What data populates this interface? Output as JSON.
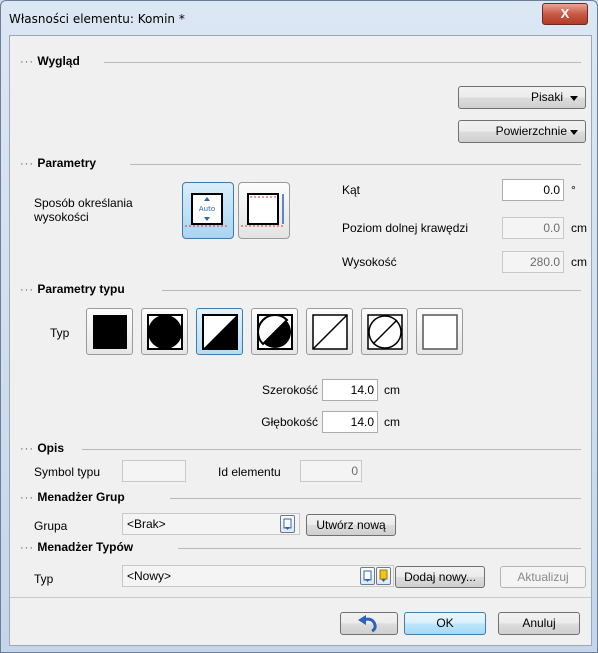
{
  "window": {
    "title": "Własności elementu: Komin *",
    "close_glyph": "X"
  },
  "sections": {
    "wyglad": "Wygląd",
    "parametry": "Parametry",
    "parametry_typu": "Parametry typu",
    "opis": "Opis",
    "menadzer_grup": "Menadżer Grup",
    "menadzer_typow": "Menadżer Typów"
  },
  "section_prefix": "···",
  "wyglad": {
    "pisaki_label": "Pisaki",
    "powierzchnie_label": "Powierzchnie"
  },
  "parametry": {
    "height_mode_label": "Sposób określania wysokości",
    "height_modes": [
      "auto",
      "manual"
    ],
    "selected_height_mode": "auto",
    "auto_text": "Auto",
    "kat_label": "Kąt",
    "kat_value": "0.0",
    "kat_unit": "°",
    "poziom_label": "Poziom dolnej krawędzi",
    "poziom_value": "0.0",
    "poziom_unit": "cm",
    "wysokosc_label": "Wysokość",
    "wysokosc_value": "280.0",
    "wysokosc_unit": "cm"
  },
  "parametry_typu": {
    "typ_label": "Typ",
    "types": [
      "square-filled",
      "square-circle-filled",
      "square-diagonal-half",
      "square-circle-diagonal",
      "square-diagonal",
      "square-circle-outline",
      "square-empty"
    ],
    "selected_type_index": 2,
    "szerokosc_label": "Szerokość",
    "szerokosc_value": "14.0",
    "szerokosc_unit": "cm",
    "glebokosc_label": "Głębokość",
    "glebokosc_value": "14.0",
    "glebokosc_unit": "cm"
  },
  "opis": {
    "symbol_label": "Symbol typu",
    "symbol_value": "",
    "id_label": "Id elementu",
    "id_value": "0"
  },
  "menadzer_grup": {
    "grupa_label": "Grupa",
    "grupa_value": "<Brak>",
    "create_button": "Utwórz nową"
  },
  "menadzer_typow": {
    "typ_label": "Typ",
    "typ_value": "<Nowy>",
    "add_button": "Dodaj nowy...",
    "update_button": "Aktualizuj"
  },
  "footer": {
    "ok": "OK",
    "cancel": "Anuluj"
  },
  "colors": {
    "accent": "#3c7fb1",
    "undo_arrow": "#2a64b8"
  }
}
